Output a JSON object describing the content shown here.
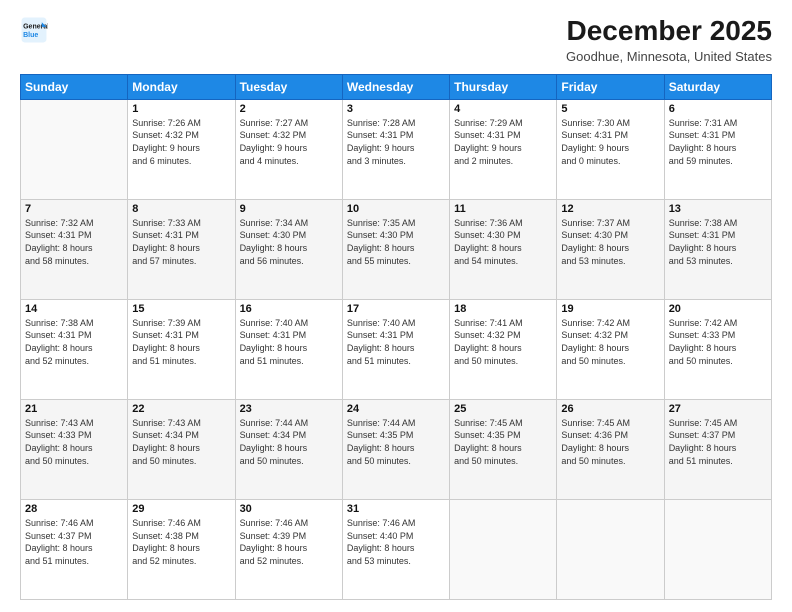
{
  "logo": {
    "line1": "General",
    "line2": "Blue"
  },
  "title": "December 2025",
  "subtitle": "Goodhue, Minnesota, United States",
  "weekdays": [
    "Sunday",
    "Monday",
    "Tuesday",
    "Wednesday",
    "Thursday",
    "Friday",
    "Saturday"
  ],
  "weeks": [
    [
      {
        "day": "",
        "info": ""
      },
      {
        "day": "1",
        "info": "Sunrise: 7:26 AM\nSunset: 4:32 PM\nDaylight: 9 hours\nand 6 minutes."
      },
      {
        "day": "2",
        "info": "Sunrise: 7:27 AM\nSunset: 4:32 PM\nDaylight: 9 hours\nand 4 minutes."
      },
      {
        "day": "3",
        "info": "Sunrise: 7:28 AM\nSunset: 4:31 PM\nDaylight: 9 hours\nand 3 minutes."
      },
      {
        "day": "4",
        "info": "Sunrise: 7:29 AM\nSunset: 4:31 PM\nDaylight: 9 hours\nand 2 minutes."
      },
      {
        "day": "5",
        "info": "Sunrise: 7:30 AM\nSunset: 4:31 PM\nDaylight: 9 hours\nand 0 minutes."
      },
      {
        "day": "6",
        "info": "Sunrise: 7:31 AM\nSunset: 4:31 PM\nDaylight: 8 hours\nand 59 minutes."
      }
    ],
    [
      {
        "day": "7",
        "info": "Sunrise: 7:32 AM\nSunset: 4:31 PM\nDaylight: 8 hours\nand 58 minutes."
      },
      {
        "day": "8",
        "info": "Sunrise: 7:33 AM\nSunset: 4:31 PM\nDaylight: 8 hours\nand 57 minutes."
      },
      {
        "day": "9",
        "info": "Sunrise: 7:34 AM\nSunset: 4:30 PM\nDaylight: 8 hours\nand 56 minutes."
      },
      {
        "day": "10",
        "info": "Sunrise: 7:35 AM\nSunset: 4:30 PM\nDaylight: 8 hours\nand 55 minutes."
      },
      {
        "day": "11",
        "info": "Sunrise: 7:36 AM\nSunset: 4:30 PM\nDaylight: 8 hours\nand 54 minutes."
      },
      {
        "day": "12",
        "info": "Sunrise: 7:37 AM\nSunset: 4:30 PM\nDaylight: 8 hours\nand 53 minutes."
      },
      {
        "day": "13",
        "info": "Sunrise: 7:38 AM\nSunset: 4:31 PM\nDaylight: 8 hours\nand 53 minutes."
      }
    ],
    [
      {
        "day": "14",
        "info": "Sunrise: 7:38 AM\nSunset: 4:31 PM\nDaylight: 8 hours\nand 52 minutes."
      },
      {
        "day": "15",
        "info": "Sunrise: 7:39 AM\nSunset: 4:31 PM\nDaylight: 8 hours\nand 51 minutes."
      },
      {
        "day": "16",
        "info": "Sunrise: 7:40 AM\nSunset: 4:31 PM\nDaylight: 8 hours\nand 51 minutes."
      },
      {
        "day": "17",
        "info": "Sunrise: 7:40 AM\nSunset: 4:31 PM\nDaylight: 8 hours\nand 51 minutes."
      },
      {
        "day": "18",
        "info": "Sunrise: 7:41 AM\nSunset: 4:32 PM\nDaylight: 8 hours\nand 50 minutes."
      },
      {
        "day": "19",
        "info": "Sunrise: 7:42 AM\nSunset: 4:32 PM\nDaylight: 8 hours\nand 50 minutes."
      },
      {
        "day": "20",
        "info": "Sunrise: 7:42 AM\nSunset: 4:33 PM\nDaylight: 8 hours\nand 50 minutes."
      }
    ],
    [
      {
        "day": "21",
        "info": "Sunrise: 7:43 AM\nSunset: 4:33 PM\nDaylight: 8 hours\nand 50 minutes."
      },
      {
        "day": "22",
        "info": "Sunrise: 7:43 AM\nSunset: 4:34 PM\nDaylight: 8 hours\nand 50 minutes."
      },
      {
        "day": "23",
        "info": "Sunrise: 7:44 AM\nSunset: 4:34 PM\nDaylight: 8 hours\nand 50 minutes."
      },
      {
        "day": "24",
        "info": "Sunrise: 7:44 AM\nSunset: 4:35 PM\nDaylight: 8 hours\nand 50 minutes."
      },
      {
        "day": "25",
        "info": "Sunrise: 7:45 AM\nSunset: 4:35 PM\nDaylight: 8 hours\nand 50 minutes."
      },
      {
        "day": "26",
        "info": "Sunrise: 7:45 AM\nSunset: 4:36 PM\nDaylight: 8 hours\nand 50 minutes."
      },
      {
        "day": "27",
        "info": "Sunrise: 7:45 AM\nSunset: 4:37 PM\nDaylight: 8 hours\nand 51 minutes."
      }
    ],
    [
      {
        "day": "28",
        "info": "Sunrise: 7:46 AM\nSunset: 4:37 PM\nDaylight: 8 hours\nand 51 minutes."
      },
      {
        "day": "29",
        "info": "Sunrise: 7:46 AM\nSunset: 4:38 PM\nDaylight: 8 hours\nand 52 minutes."
      },
      {
        "day": "30",
        "info": "Sunrise: 7:46 AM\nSunset: 4:39 PM\nDaylight: 8 hours\nand 52 minutes."
      },
      {
        "day": "31",
        "info": "Sunrise: 7:46 AM\nSunset: 4:40 PM\nDaylight: 8 hours\nand 53 minutes."
      },
      {
        "day": "",
        "info": ""
      },
      {
        "day": "",
        "info": ""
      },
      {
        "day": "",
        "info": ""
      }
    ]
  ]
}
